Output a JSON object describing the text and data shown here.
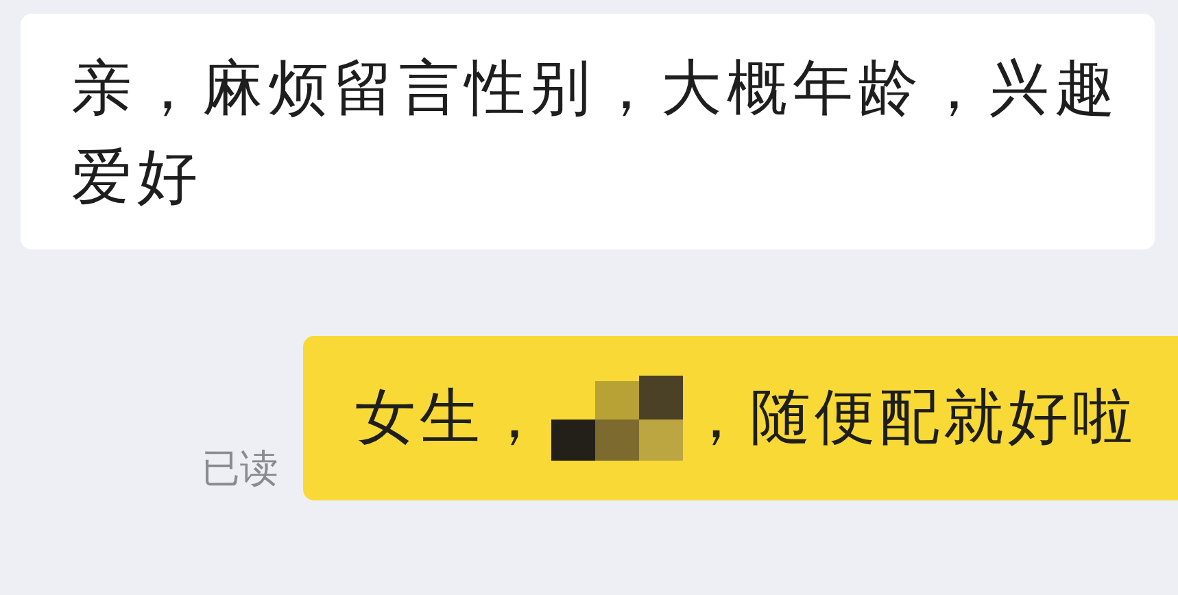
{
  "messages": [
    {
      "kind": "received",
      "parts": [
        {
          "kind": "text",
          "text": "亲，麻烦留言性别，大概年龄，兴趣爱好"
        }
      ]
    },
    {
      "kind": "sent",
      "read_receipt": "已读",
      "parts": [
        {
          "kind": "text",
          "text": "女生，"
        },
        {
          "kind": "redacted"
        },
        {
          "kind": "text",
          "text": "，随便配就好啦"
        }
      ]
    }
  ]
}
